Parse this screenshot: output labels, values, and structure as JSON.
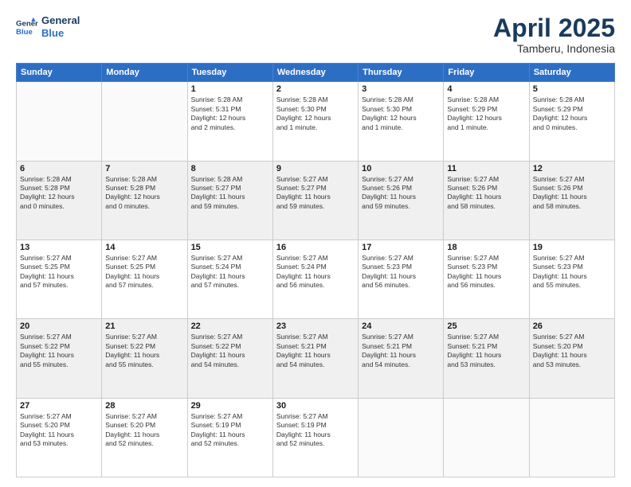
{
  "logo": {
    "line1": "General",
    "line2": "Blue"
  },
  "title": "April 2025",
  "location": "Tamberu, Indonesia",
  "days_header": [
    "Sunday",
    "Monday",
    "Tuesday",
    "Wednesday",
    "Thursday",
    "Friday",
    "Saturday"
  ],
  "weeks": [
    [
      {
        "day": "",
        "text": ""
      },
      {
        "day": "",
        "text": ""
      },
      {
        "day": "1",
        "text": "Sunrise: 5:28 AM\nSunset: 5:31 PM\nDaylight: 12 hours\nand 2 minutes."
      },
      {
        "day": "2",
        "text": "Sunrise: 5:28 AM\nSunset: 5:30 PM\nDaylight: 12 hours\nand 1 minute."
      },
      {
        "day": "3",
        "text": "Sunrise: 5:28 AM\nSunset: 5:30 PM\nDaylight: 12 hours\nand 1 minute."
      },
      {
        "day": "4",
        "text": "Sunrise: 5:28 AM\nSunset: 5:29 PM\nDaylight: 12 hours\nand 1 minute."
      },
      {
        "day": "5",
        "text": "Sunrise: 5:28 AM\nSunset: 5:29 PM\nDaylight: 12 hours\nand 0 minutes."
      }
    ],
    [
      {
        "day": "6",
        "text": "Sunrise: 5:28 AM\nSunset: 5:28 PM\nDaylight: 12 hours\nand 0 minutes."
      },
      {
        "day": "7",
        "text": "Sunrise: 5:28 AM\nSunset: 5:28 PM\nDaylight: 12 hours\nand 0 minutes."
      },
      {
        "day": "8",
        "text": "Sunrise: 5:28 AM\nSunset: 5:27 PM\nDaylight: 11 hours\nand 59 minutes."
      },
      {
        "day": "9",
        "text": "Sunrise: 5:27 AM\nSunset: 5:27 PM\nDaylight: 11 hours\nand 59 minutes."
      },
      {
        "day": "10",
        "text": "Sunrise: 5:27 AM\nSunset: 5:26 PM\nDaylight: 11 hours\nand 59 minutes."
      },
      {
        "day": "11",
        "text": "Sunrise: 5:27 AM\nSunset: 5:26 PM\nDaylight: 11 hours\nand 58 minutes."
      },
      {
        "day": "12",
        "text": "Sunrise: 5:27 AM\nSunset: 5:26 PM\nDaylight: 11 hours\nand 58 minutes."
      }
    ],
    [
      {
        "day": "13",
        "text": "Sunrise: 5:27 AM\nSunset: 5:25 PM\nDaylight: 11 hours\nand 57 minutes."
      },
      {
        "day": "14",
        "text": "Sunrise: 5:27 AM\nSunset: 5:25 PM\nDaylight: 11 hours\nand 57 minutes."
      },
      {
        "day": "15",
        "text": "Sunrise: 5:27 AM\nSunset: 5:24 PM\nDaylight: 11 hours\nand 57 minutes."
      },
      {
        "day": "16",
        "text": "Sunrise: 5:27 AM\nSunset: 5:24 PM\nDaylight: 11 hours\nand 56 minutes."
      },
      {
        "day": "17",
        "text": "Sunrise: 5:27 AM\nSunset: 5:23 PM\nDaylight: 11 hours\nand 56 minutes."
      },
      {
        "day": "18",
        "text": "Sunrise: 5:27 AM\nSunset: 5:23 PM\nDaylight: 11 hours\nand 56 minutes."
      },
      {
        "day": "19",
        "text": "Sunrise: 5:27 AM\nSunset: 5:23 PM\nDaylight: 11 hours\nand 55 minutes."
      }
    ],
    [
      {
        "day": "20",
        "text": "Sunrise: 5:27 AM\nSunset: 5:22 PM\nDaylight: 11 hours\nand 55 minutes."
      },
      {
        "day": "21",
        "text": "Sunrise: 5:27 AM\nSunset: 5:22 PM\nDaylight: 11 hours\nand 55 minutes."
      },
      {
        "day": "22",
        "text": "Sunrise: 5:27 AM\nSunset: 5:22 PM\nDaylight: 11 hours\nand 54 minutes."
      },
      {
        "day": "23",
        "text": "Sunrise: 5:27 AM\nSunset: 5:21 PM\nDaylight: 11 hours\nand 54 minutes."
      },
      {
        "day": "24",
        "text": "Sunrise: 5:27 AM\nSunset: 5:21 PM\nDaylight: 11 hours\nand 54 minutes."
      },
      {
        "day": "25",
        "text": "Sunrise: 5:27 AM\nSunset: 5:21 PM\nDaylight: 11 hours\nand 53 minutes."
      },
      {
        "day": "26",
        "text": "Sunrise: 5:27 AM\nSunset: 5:20 PM\nDaylight: 11 hours\nand 53 minutes."
      }
    ],
    [
      {
        "day": "27",
        "text": "Sunrise: 5:27 AM\nSunset: 5:20 PM\nDaylight: 11 hours\nand 53 minutes."
      },
      {
        "day": "28",
        "text": "Sunrise: 5:27 AM\nSunset: 5:20 PM\nDaylight: 11 hours\nand 52 minutes."
      },
      {
        "day": "29",
        "text": "Sunrise: 5:27 AM\nSunset: 5:19 PM\nDaylight: 11 hours\nand 52 minutes."
      },
      {
        "day": "30",
        "text": "Sunrise: 5:27 AM\nSunset: 5:19 PM\nDaylight: 11 hours\nand 52 minutes."
      },
      {
        "day": "",
        "text": ""
      },
      {
        "day": "",
        "text": ""
      },
      {
        "day": "",
        "text": ""
      }
    ]
  ]
}
